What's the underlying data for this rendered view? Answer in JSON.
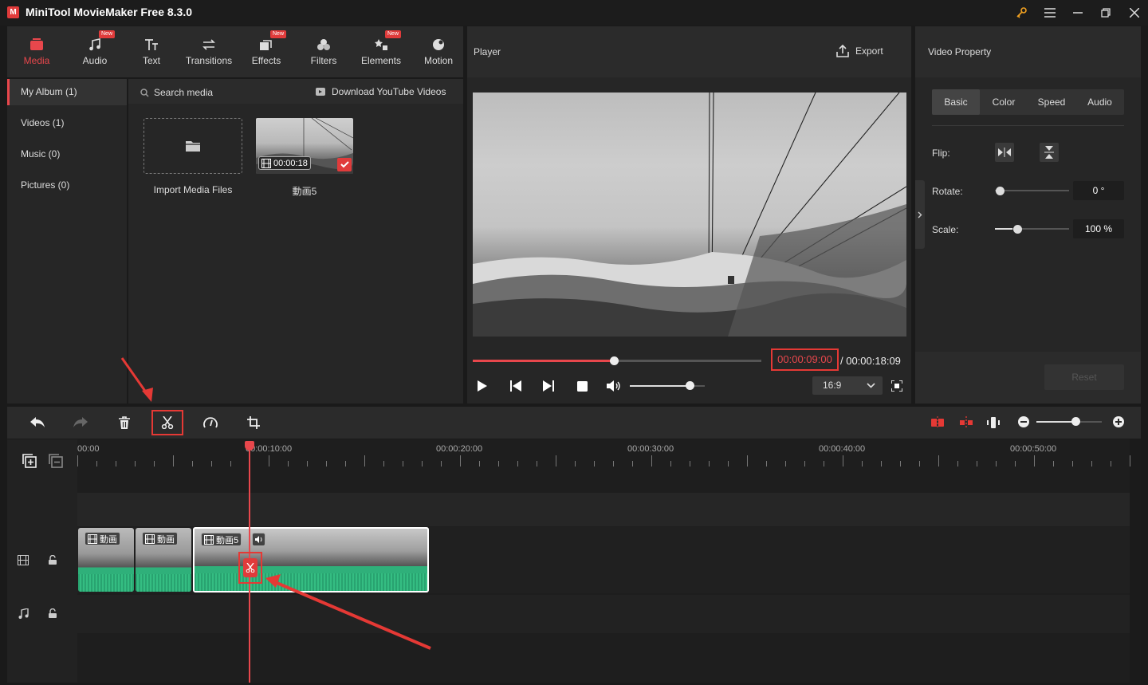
{
  "app": {
    "title": "MiniTool MovieMaker Free 8.3.0",
    "logo_letter": "M"
  },
  "toolbar": [
    {
      "label": "Media",
      "icon": "media-icon",
      "new": false,
      "active": true
    },
    {
      "label": "Audio",
      "icon": "audio-icon",
      "new": true
    },
    {
      "label": "Text",
      "icon": "text-icon",
      "new": false
    },
    {
      "label": "Transitions",
      "icon": "transitions-icon",
      "new": false
    },
    {
      "label": "Effects",
      "icon": "effects-icon",
      "new": true
    },
    {
      "label": "Filters",
      "icon": "filters-icon",
      "new": false
    },
    {
      "label": "Elements",
      "icon": "elements-icon",
      "new": true
    },
    {
      "label": "Motion",
      "icon": "motion-icon",
      "new": false
    }
  ],
  "new_badge": "New",
  "sidebar": [
    {
      "label": "My Album (1)",
      "active": true
    },
    {
      "label": "Videos (1)"
    },
    {
      "label": "Music (0)"
    },
    {
      "label": "Pictures (0)"
    }
  ],
  "media": {
    "search_label": "Search media",
    "download_label": "Download YouTube Videos",
    "import_label": "Import Media Files",
    "clip_name": "動画5",
    "clip_duration": "00:00:18"
  },
  "player": {
    "title": "Player",
    "export_label": "Export",
    "current_time": "00:00:09:00",
    "total_time": "/ 00:00:18:09",
    "progress": 0.49,
    "volume": 0.8,
    "aspect": "16:9"
  },
  "property": {
    "title": "Video Property",
    "tabs": [
      "Basic",
      "Color",
      "Speed",
      "Audio"
    ],
    "flip_label": "Flip:",
    "rotate_label": "Rotate:",
    "rotate_value": "0 °",
    "rotate_level": 0.0,
    "scale_label": "Scale:",
    "scale_value": "100 %",
    "scale_level": 0.25,
    "reset_label": "Reset"
  },
  "timeline": {
    "ruler_labels": [
      "00:00",
      "00:00:10:00",
      "00:00:20:00",
      "00:00:30:00",
      "00:00:40:00",
      "00:00:50:00"
    ],
    "clip_labels": [
      "動画",
      "動画",
      "動画5"
    ],
    "zoom_level": 0.6
  },
  "colors": {
    "accent": "#e8474c",
    "audio": "#2fb07a",
    "highlight": "#e53935"
  }
}
